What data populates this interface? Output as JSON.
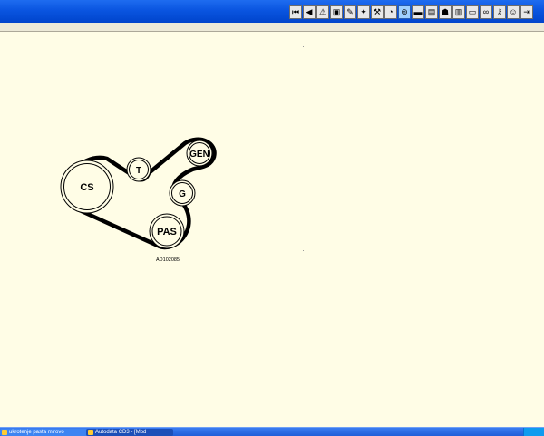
{
  "toolbar": {
    "buttons": [
      {
        "name": "first-page-icon",
        "glyph": "⏮"
      },
      {
        "name": "previous-icon",
        "glyph": "◀"
      },
      {
        "name": "warning-icon",
        "glyph": "⚠"
      },
      {
        "name": "engine-icon",
        "glyph": "▣"
      },
      {
        "name": "tool-icon",
        "glyph": "✎"
      },
      {
        "name": "puzzle-icon",
        "glyph": "✦"
      },
      {
        "name": "wrench-icon",
        "glyph": "⚒"
      },
      {
        "name": "gauge-icon",
        "glyph": "◔"
      },
      {
        "name": "belt-icon",
        "glyph": "⊚"
      },
      {
        "name": "car-icon",
        "glyph": "▬"
      },
      {
        "name": "chart-icon",
        "glyph": "▤"
      },
      {
        "name": "person-icon",
        "glyph": "☗"
      },
      {
        "name": "book-icon",
        "glyph": "▥"
      },
      {
        "name": "screen-icon",
        "glyph": "▭"
      },
      {
        "name": "chain-icon",
        "glyph": "∞"
      },
      {
        "name": "key-icon",
        "glyph": "⚷"
      },
      {
        "name": "user-icon",
        "glyph": "☺"
      },
      {
        "name": "exit-icon",
        "glyph": "⇥"
      }
    ],
    "pressed_index": 8
  },
  "diagram": {
    "pulleys": {
      "cs": "CS",
      "t": "T",
      "gen": "GEN",
      "g": "G",
      "pas": "PAS"
    },
    "code": "AD102085"
  },
  "taskbar": {
    "items": [
      "ukrotenje pasta mirovo",
      "Autodata CD3 - [Mod"
    ]
  }
}
